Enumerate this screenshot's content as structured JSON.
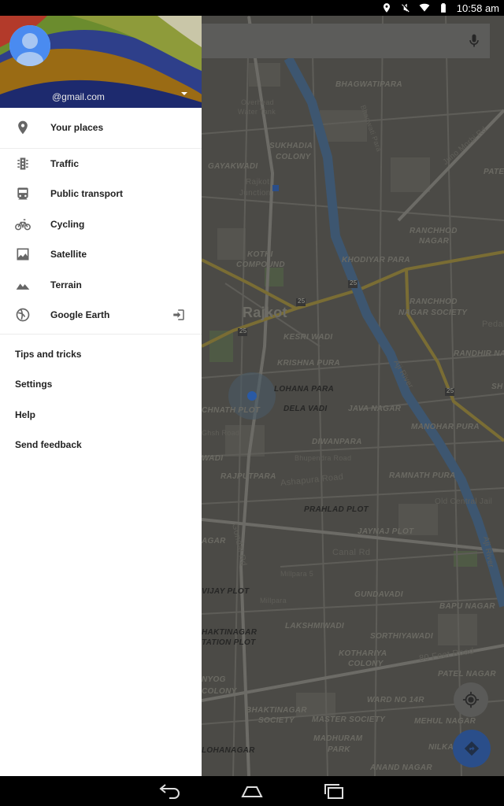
{
  "status_bar": {
    "time": "10:58 am",
    "icons": [
      "location-icon",
      "mute-icon",
      "wifi-icon",
      "battery-icon"
    ]
  },
  "drawer": {
    "account_email": "@gmail.com",
    "primary_items": [
      {
        "label": "Your places",
        "icon": "place-pin-icon"
      }
    ],
    "layer_items": [
      {
        "label": "Traffic",
        "icon": "traffic-light-icon"
      },
      {
        "label": "Public transport",
        "icon": "train-icon"
      },
      {
        "label": "Cycling",
        "icon": "bicycle-icon"
      },
      {
        "label": "Satellite",
        "icon": "satellite-image-icon"
      },
      {
        "label": "Terrain",
        "icon": "mountain-icon"
      },
      {
        "label": "Google Earth",
        "icon": "earth-icon",
        "trailing_icon": "open-external-icon"
      }
    ],
    "text_items": [
      "Tips and tricks",
      "Settings",
      "Help",
      "Send feedback"
    ]
  },
  "map": {
    "labels": {
      "city": "Rajkot",
      "bhagwatipara": "BHAGWATIPARA",
      "overhead": "Overhead",
      "water_tank": "Water Tank",
      "bhagwati_para": "Bhagwati Para",
      "junc_rd": "Juno Morbi Rd",
      "pate": "PATE",
      "sukhadia": "SUKHADIA",
      "colony": "COLONY",
      "gayakwadi": "GAYAKWADI",
      "rajkot_junction_1": "Rajkot",
      "rajkot_junction_2": "Junction",
      "ranchhod": "RANCHHOD",
      "nagar": "NAGAR",
      "kothi": "KOTHI",
      "compound": "COMPOUND",
      "khodiyar": "KHODIYAR PARA",
      "ranchhod2": "RANCHHOD",
      "nagar_society": "NAGAR SOCIETY",
      "pedal": "Pedal",
      "kesri_wadi": "KESRI WADI",
      "randhir": "RANDHIR NA",
      "krishna_pura": "KRISHNA PURA",
      "aji_river": "Aji River",
      "lohana_para": "LOHANA PARA",
      "sh": "SH",
      "chnath_plot": "CHNATH PLOT",
      "dela_vadi": "DELA VADI",
      "java_nagar": "JAVA NAGAR",
      "manohar_pura": "MANOHAR PURA",
      "ghsh_road": "Ghsh Road",
      "diwanpara": "DIWANPARA",
      "bhupendra_road": "Bhupendra Road",
      "wadi": "WADI",
      "rajputpara": "RAJPUTPARA",
      "ramnath_pura": "RAMNATH PURA",
      "ashapura_road": "Ashapura Road",
      "old_central_jail": "Old Central Jail",
      "prahlad_plot": "PRAHLAD PLOT",
      "jaynaj_plot": "JAYNAJ PLOT",
      "aji_river2": "Aji River",
      "gondal_rd": "Gondal Rd",
      "agar": "AGAR",
      "canal_rd": "Canal Rd",
      "millpara_5": "Millpara 5",
      "vijay_plot": "VIJAY PLOT",
      "gundavadi": "GUNDAVADI",
      "millpara": "Millpara",
      "bapu_nagar": "BAPU NAGAR",
      "lakshmiwadi": "LAKSHMIWADI",
      "haktinagar": "HAKTINAGAR",
      "sorthiyawadi": "SORTHIYAWADI",
      "tation_plot": "TATION PLOT",
      "kothariya": "KOTHARIYA",
      "colony2": "COLONY",
      "eighty_feet": "80 Feet Road",
      "patel_nagar": "PATEL NAGAR",
      "nyog": "NYOG",
      "colony3": "COLONY",
      "ward_no": "WARD NO 14R",
      "bhaktinagar": "BHAKTINAGAR",
      "society": "SOCIETY",
      "master_society": "MASTER SOCIETY",
      "mehul_nagar": "MEHUL NAGAR",
      "lohanagar": "LOHANAGAR",
      "madhuram": "MADHURAM",
      "park": "PARK",
      "nilka": "NILKA",
      "anand_nagar": "ANAND NAGAR",
      "hwy_1": "25",
      "hwy_2": "25",
      "hwy_3": "25",
      "hwy_4": "25",
      "hwy_5": "25"
    }
  },
  "nav_bar": {
    "buttons": [
      "back-icon",
      "home-icon",
      "recents-icon"
    ]
  }
}
